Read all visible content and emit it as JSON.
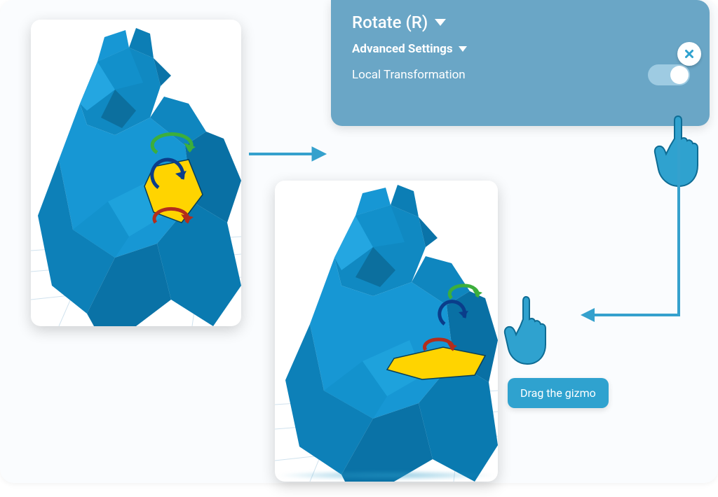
{
  "panel": {
    "title": "Rotate (R)",
    "section": "Advanced Settings",
    "option_label": "Local Transformation",
    "toggle_on": true
  },
  "tooltip": {
    "text": "Drag the gizmo"
  },
  "icons": {
    "close": "close-icon",
    "hand": "hand-pointer-icon",
    "caret": "caret-down-icon"
  },
  "colors": {
    "panel_bg": "#6aa6c6",
    "accent": "#2fa2cf",
    "model": "#1d9bd1",
    "highlight": "#ffd400"
  }
}
